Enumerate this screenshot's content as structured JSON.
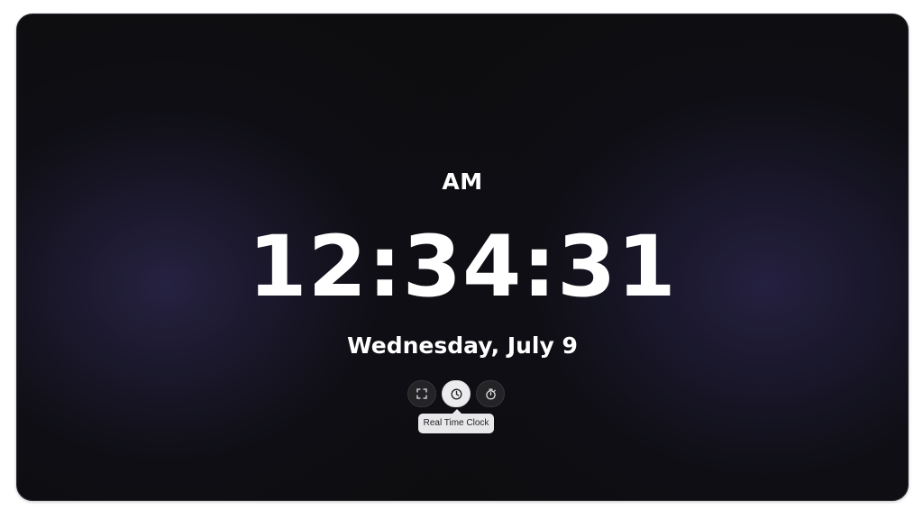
{
  "clock": {
    "period": "AM",
    "time": "12:34:31",
    "date": "Wednesday, July 9"
  },
  "controls": [
    {
      "icon": "fullscreen-icon",
      "active": false
    },
    {
      "icon": "clock-icon",
      "active": true
    },
    {
      "icon": "stopwatch-icon",
      "active": false
    }
  ],
  "tooltip": {
    "text": "Real Time Clock"
  },
  "colors": {
    "background": "#0d0d0f",
    "glow": "#2e2852",
    "text": "#ffffff",
    "active_button": "#ececee"
  }
}
